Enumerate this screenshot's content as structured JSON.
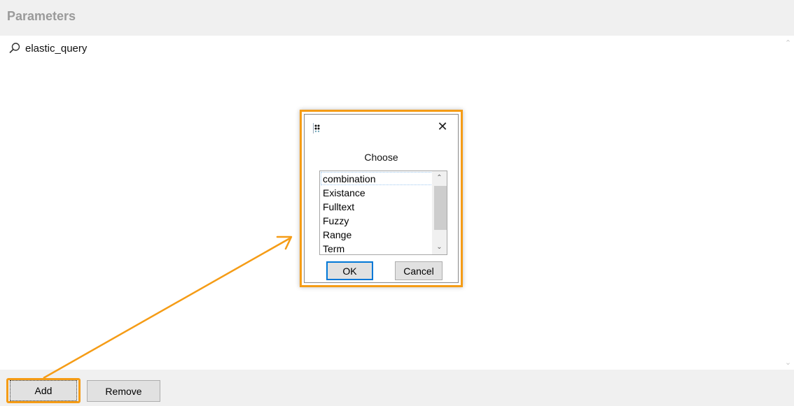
{
  "header": {
    "title": "Parameters"
  },
  "parameters": {
    "items": [
      {
        "label": "elastic_query",
        "icon": "search-icon"
      }
    ]
  },
  "footer": {
    "add_label": "Add",
    "remove_label": "Remove"
  },
  "dialog": {
    "caption": "Choose",
    "app_icon": "app-grid-icon",
    "close_icon": "close-icon",
    "options": [
      "combination",
      "Existance",
      "Fulltext",
      "Fuzzy",
      "Range",
      "Term"
    ],
    "ok_label": "OK",
    "cancel_label": "Cancel"
  },
  "colors": {
    "highlight": "#f59c16",
    "focus_border": "#0078d7"
  }
}
